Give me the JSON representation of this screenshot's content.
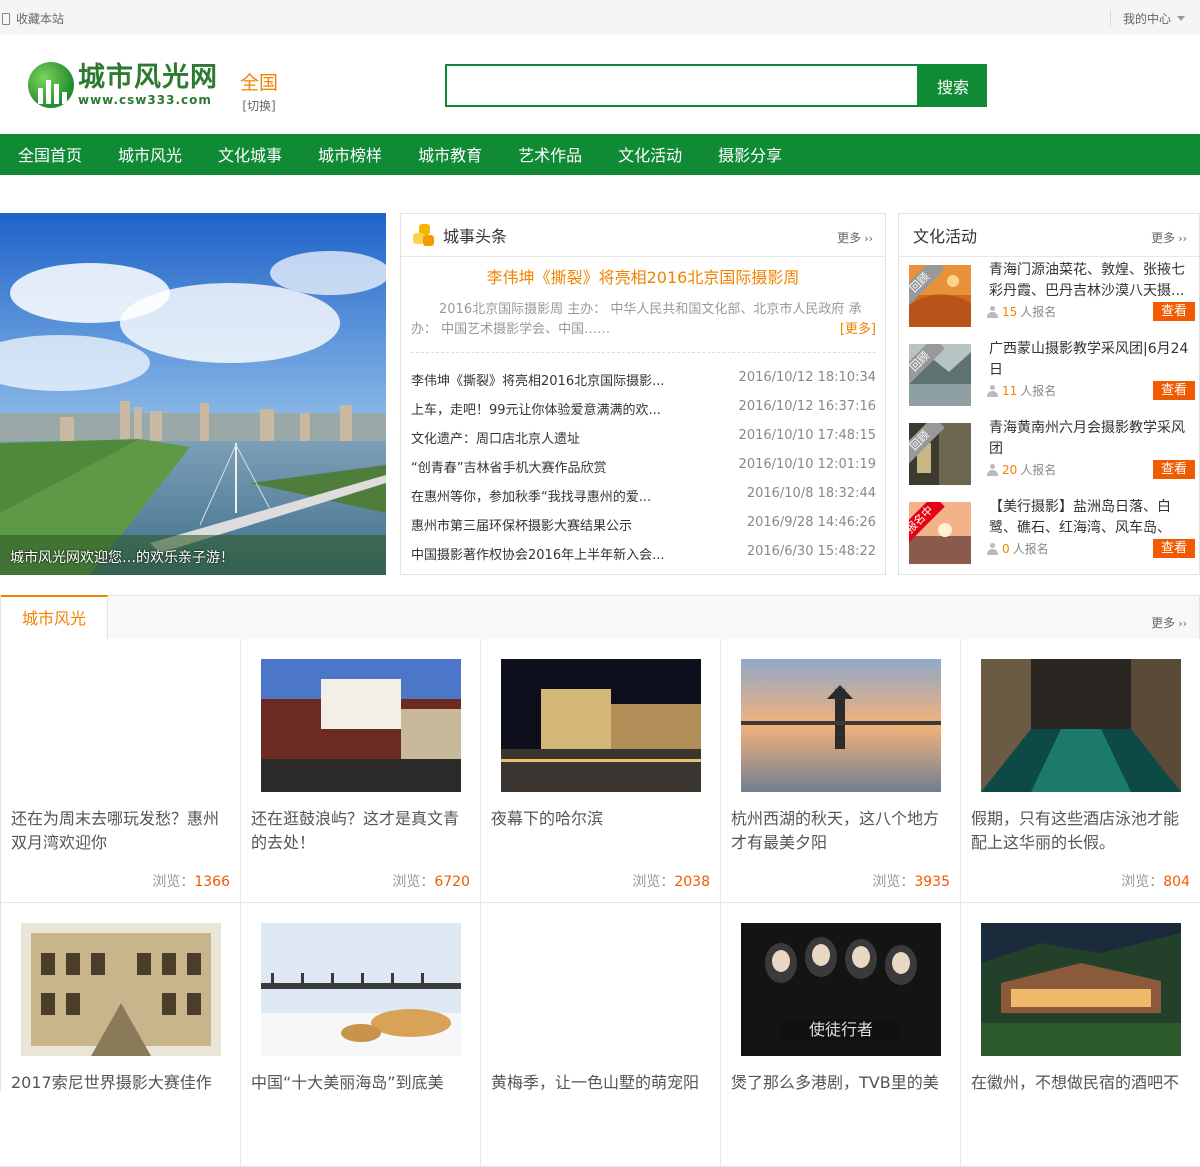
{
  "topbar": {
    "favorite": "收藏本站",
    "user_center": "我的中心"
  },
  "header": {
    "logo_cn": "城市风光网",
    "logo_en": "www.csw333.com",
    "city_name": "全国",
    "city_switch": "[切换]",
    "search_placeholder": "",
    "search_button": "搜索"
  },
  "nav": {
    "items": [
      "全国首页",
      "城市风光",
      "文化城事",
      "城市榜样",
      "城市教育",
      "艺术作品",
      "文化活动",
      "摄影分享"
    ]
  },
  "banner": {
    "caption": "城市风光网欢迎您…的欢乐亲子游！"
  },
  "headlines": {
    "title": "城事头条",
    "more": "更多",
    "lead_title": "李伟坤《撕裂》将亮相2016北京国际摄影周",
    "lead_summary": "2016北京国际摄影周 主办： 中华人民共和国文化部、北京市人民政府 承办： 中国艺术摄影学会、中国……",
    "lead_more": "[更多]",
    "items": [
      {
        "title": "李伟坤《撕裂》将亮相2016北京国际摄影...",
        "date": "2016/10/12 18:10:34"
      },
      {
        "title": "上车，走吧！99元让你体验爱意满满的欢...",
        "date": "2016/10/12 16:37:16"
      },
      {
        "title": "文化遗产：周口店北京人遗址",
        "date": "2016/10/10 17:48:15"
      },
      {
        "title": "“创青春”吉林省手机大赛作品欣赏",
        "date": "2016/10/10 12:01:19"
      },
      {
        "title": "在惠州等你，参加秋季“我找寻惠州的爱...",
        "date": "2016/10/8 18:32:44"
      },
      {
        "title": "惠州市第三届环保杯摄影大赛结果公示",
        "date": "2016/9/28 14:46:26"
      },
      {
        "title": "中国摄影著作权协会2016年上半年新入会...",
        "date": "2016/6/30 15:48:22"
      }
    ]
  },
  "activities": {
    "title": "文化活动",
    "more": "更多",
    "signup_suffix": "人报名",
    "button": "查看",
    "items": [
      {
        "title": "青海门源油菜花、敦煌、张掖七彩丹霞、巴丹吉林沙漠八天摄...",
        "count": "15",
        "tag": "回顾"
      },
      {
        "title": "广西蒙山摄影教学采风团|6月24日",
        "count": "11",
        "tag": "回顾"
      },
      {
        "title": "青海黄南州六月会摄影教学采风团",
        "count": "20",
        "tag": "回顾"
      },
      {
        "title": "【美行摄影】盐洲岛日落、白鹭、礁石、红海湾、风车岛、美...",
        "count": "0",
        "tag": "报名中"
      }
    ]
  },
  "city_section": {
    "tab": "城市风光",
    "more": "更多",
    "views_label": "浏览：",
    "cards": [
      {
        "title": "还在为周末去哪玩发愁？惠州双月湾欢迎你",
        "views": "1366"
      },
      {
        "title": "还在逛鼓浪屿？这才是真文青的去处！",
        "views": "6720"
      },
      {
        "title": "夜幕下的哈尔滨",
        "views": "2038"
      },
      {
        "title": "杭州西湖的秋天，这八个地方才有最美夕阳",
        "views": "3935"
      },
      {
        "title": "假期，只有这些酒店泳池才能配上这华丽的长假。",
        "views": "804"
      },
      {
        "title": "2017索尼世界摄影大赛佳作",
        "views": ""
      },
      {
        "title": "中国“十大美丽海岛”到底美",
        "views": ""
      },
      {
        "title": "黄梅季，让一色山墅的萌宠阳",
        "views": ""
      },
      {
        "title": "煲了那么多港剧，TVB里的美",
        "views": ""
      },
      {
        "title": "在徽州，不想做民宿的酒吧不",
        "views": ""
      }
    ]
  },
  "colors": {
    "brand_green": "#108a34",
    "accent_orange": "#f08300",
    "button_orange": "#f05a00"
  }
}
